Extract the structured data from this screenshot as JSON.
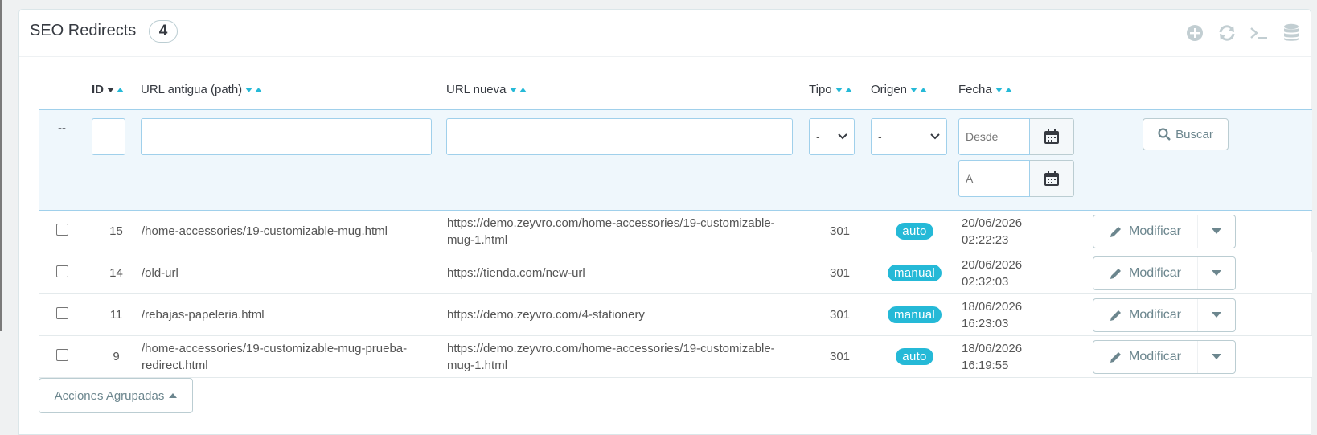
{
  "panel": {
    "title": "SEO Redirects",
    "count": "4"
  },
  "toolbar": {
    "icons": [
      "add-new-icon",
      "refresh-icon",
      "sql-query-icon",
      "export-database-icon"
    ]
  },
  "columns": {
    "id": "ID",
    "old_url": "URL antigua (path)",
    "new_url": "URL nueva",
    "type": "Tipo",
    "origin": "Origen",
    "date": "Fecha"
  },
  "filters": {
    "bulk_placeholder": "--",
    "type_value": "-",
    "origin_value": "-",
    "date_from_placeholder": "Desde",
    "date_to_placeholder": "A",
    "search_label": "Buscar"
  },
  "rows": [
    {
      "id": "15",
      "old_url": "/home-accessories/19-customizable-mug.html",
      "new_url_1": "https://demo.zeyvro.com/home-accessories/19-customizable-",
      "new_url_2": "mug-1.html",
      "type": "301",
      "origin": "auto",
      "date_1": "20/06/2026",
      "date_2": "02:22:23",
      "action": "Modificar"
    },
    {
      "id": "14",
      "old_url": "/old-url",
      "new_url_1": "https://tienda.com/new-url",
      "new_url_2": "",
      "type": "301",
      "origin": "manual",
      "date_1": "20/06/2026",
      "date_2": "02:32:03",
      "action": "Modificar"
    },
    {
      "id": "11",
      "old_url": "/rebajas-papeleria.html",
      "new_url_1": "https://demo.zeyvro.com/4-stationery",
      "new_url_2": "",
      "type": "301",
      "origin": "manual",
      "date_1": "18/06/2026",
      "date_2": "16:23:03",
      "action": "Modificar"
    },
    {
      "id": "9",
      "old_url_1": "/home-accessories/19-customizable-mug-prueba-",
      "old_url_2": "redirect.html",
      "new_url_1": "https://demo.zeyvro.com/home-accessories/19-customizable-",
      "new_url_2": "mug-1.html",
      "type": "301",
      "origin": "auto",
      "date_1": "18/06/2026",
      "date_2": "16:19:55",
      "action": "Modificar"
    }
  ],
  "bulk_actions": {
    "label": "Acciones Agrupadas"
  },
  "colors": {
    "accent": "#25b9d7",
    "text": "#363a41",
    "muted": "#6c868e",
    "filter_bg": "#eff7fc"
  }
}
